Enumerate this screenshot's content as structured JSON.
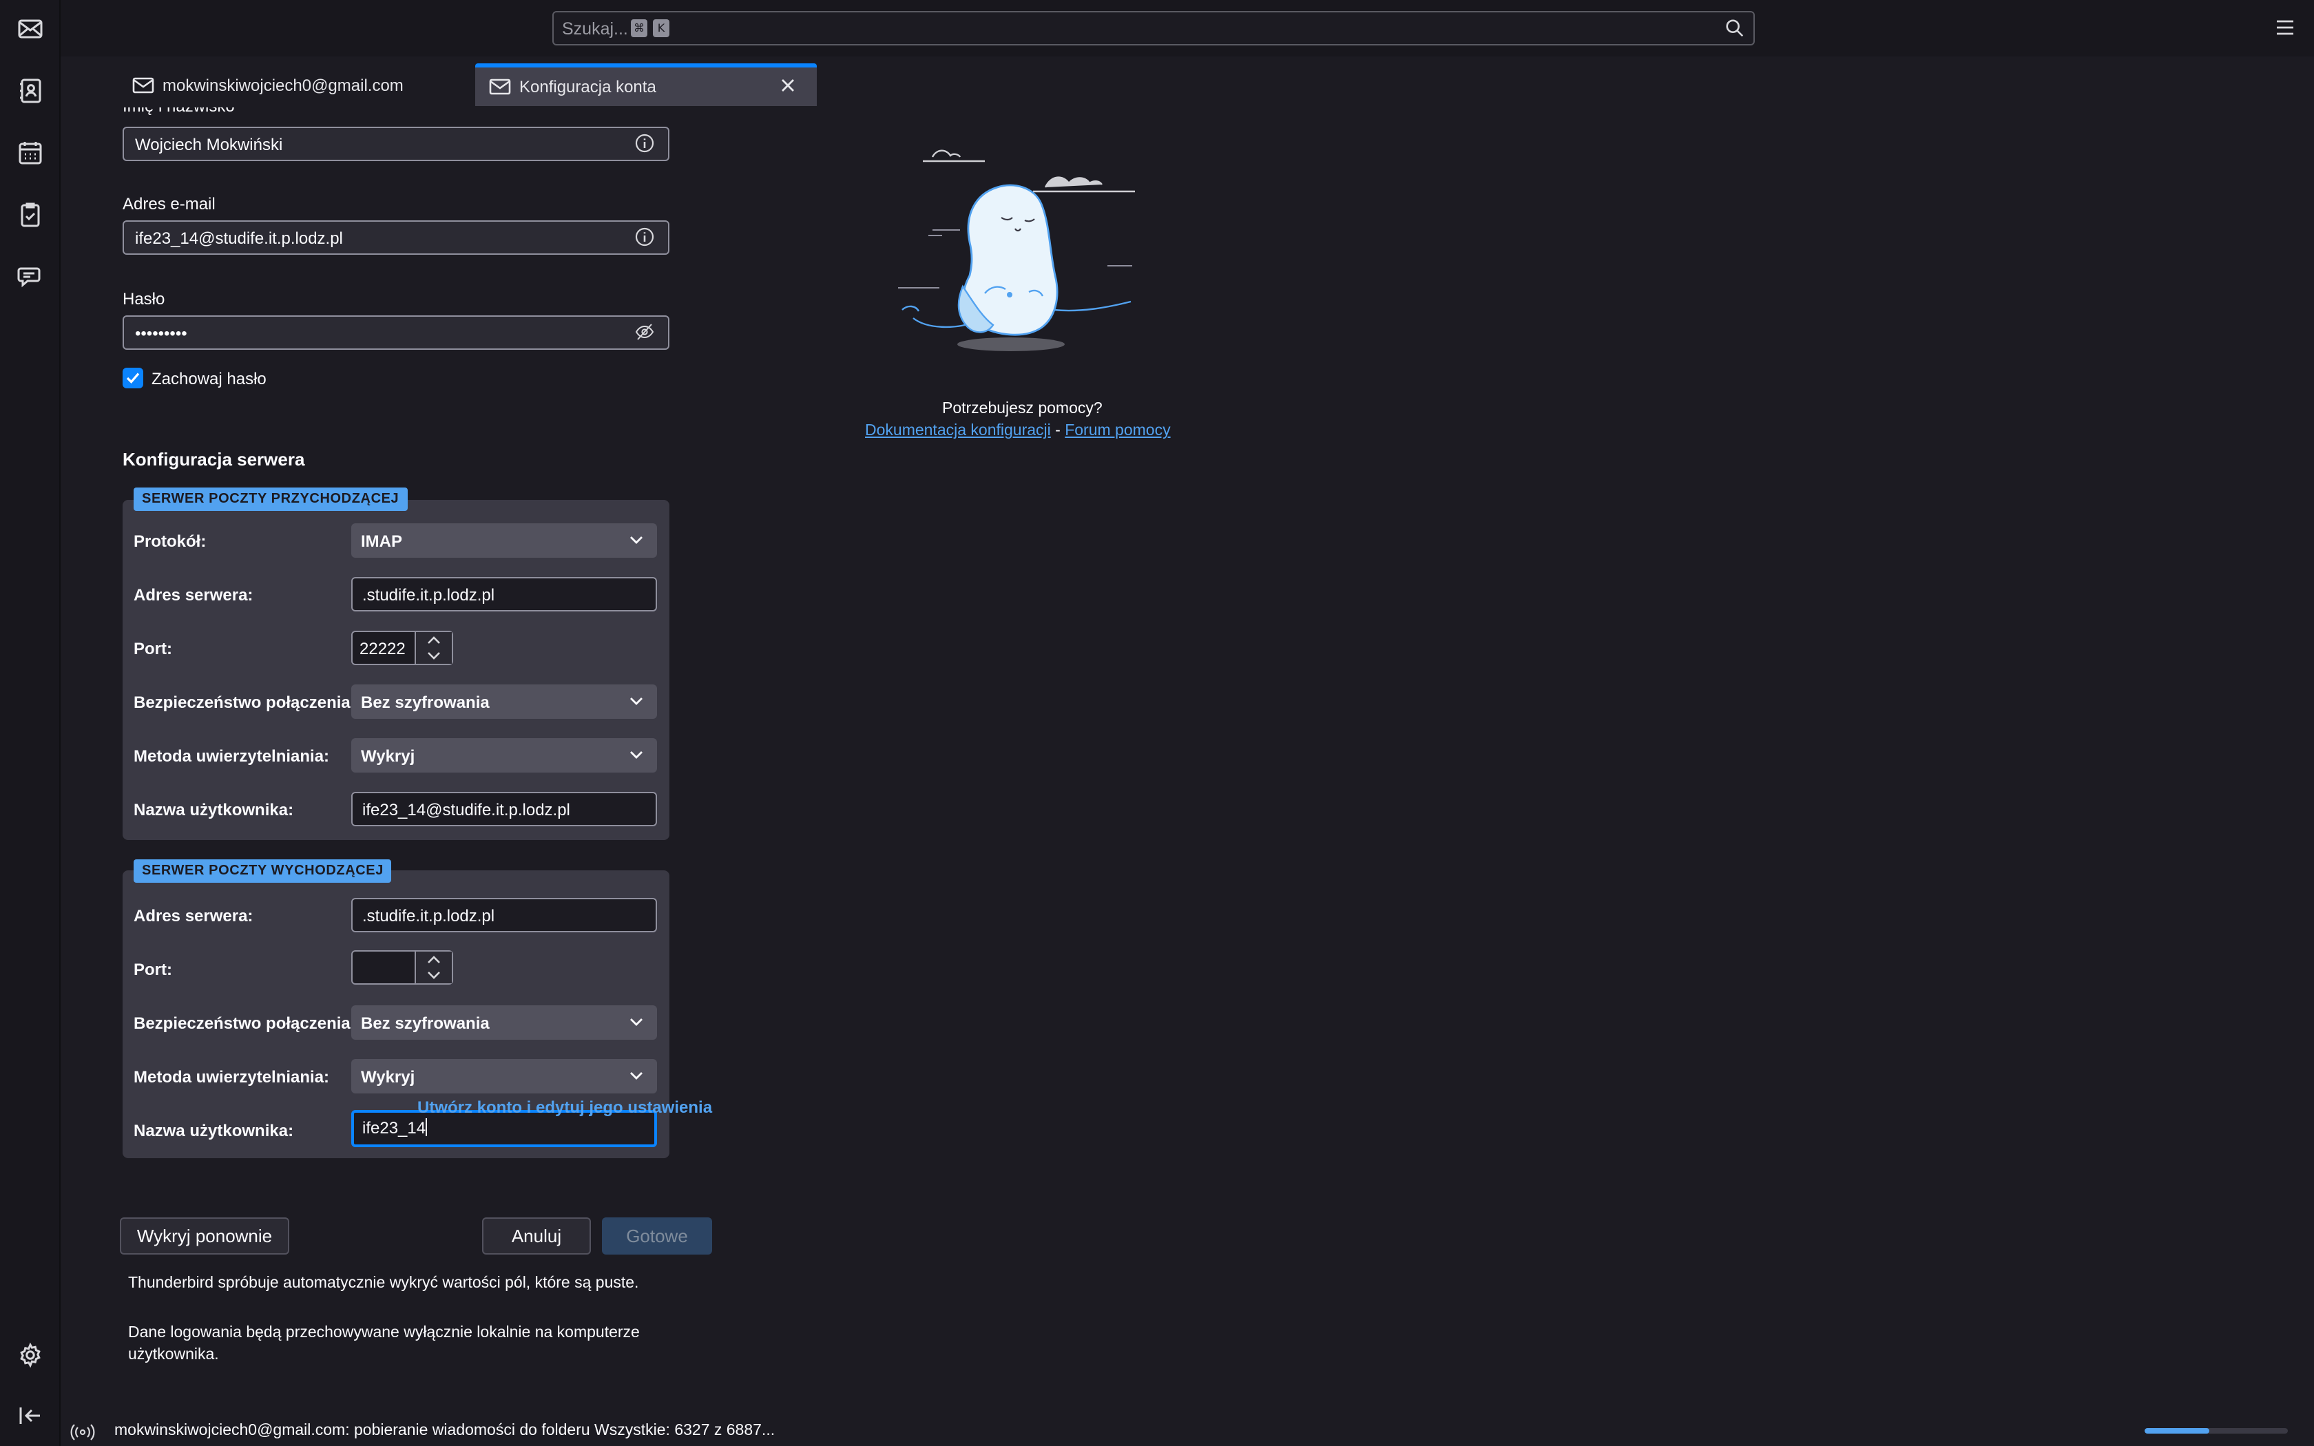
{
  "search": {
    "placeholder": "Szukaj...",
    "kbd1": "⌘",
    "kbd2": "K"
  },
  "tabs": [
    {
      "label": "mokwinskiwojciech0@gmail.com"
    },
    {
      "label": "Konfiguracja konta"
    }
  ],
  "form": {
    "name_label": "Imię i nazwisko",
    "name_value": "Wojciech Mokwiński",
    "email_label": "Adres e-mail",
    "email_value": "ife23_14@studife.it.p.lodz.pl",
    "password_label": "Hasło",
    "password_value": "•••••••••",
    "remember_label": "Zachowaj hasło",
    "remember_checked": true
  },
  "server_config": {
    "title": "Konfiguracja serwera",
    "incoming": {
      "badge": "SERWER POCZTY PRZYCHODZĄCEJ",
      "protocol_label": "Protokół:",
      "protocol_value": "IMAP",
      "address_label": "Adres serwera:",
      "address_value": ".studife.it.p.lodz.pl",
      "port_label": "Port:",
      "port_value": "22222",
      "security_label": "Bezpieczeństwo połączenia:",
      "security_value": "Bez szyfrowania",
      "auth_label": "Metoda uwierzytelniania:",
      "auth_value": "Wykryj",
      "username_label": "Nazwa użytkownika:",
      "username_value": "ife23_14@studife.it.p.lodz.pl"
    },
    "outgoing": {
      "badge": "SERWER POCZTY WYCHODZĄCEJ",
      "address_label": "Adres serwera:",
      "address_value": ".studife.it.p.lodz.pl",
      "port_label": "Port:",
      "port_value": "",
      "security_label": "Bezpieczeństwo połączenia:",
      "security_value": "Bez szyfrowania",
      "auth_label": "Metoda uwierzytelniania:",
      "auth_value": "Wykryj",
      "username_label": "Nazwa użytkownika:",
      "username_value": "ife23_14"
    }
  },
  "actions": {
    "create_link": "Utwórz konto i edytuj jego ustawienia",
    "redetect": "Wykryj ponownie",
    "cancel": "Anuluj",
    "done": "Gotowe"
  },
  "notes": {
    "auto_detect": "Thunderbird spróbuje automatycznie wykryć wartości pól, które są puste.",
    "local_storage": "Dane logowania będą przechowywane wyłącznie lokalnie na komputerze użytkownika."
  },
  "help": {
    "title": "Potrzebujesz pomocy?",
    "doc_link": "Dokumentacja konfiguracji",
    "separator": " - ",
    "forum_link": "Forum pomocy"
  },
  "status": {
    "text": "mokwinskiwojciech0@gmail.com: pobieranie wiadomości do folderu Wszystkie: 6327 z 6887...",
    "progress_fraction": 0.45
  },
  "colors": {
    "accent": "#0a84ff",
    "link": "#52a2f0",
    "background": "#1c1b22"
  },
  "icons": [
    "mail-icon",
    "address-book-icon",
    "calendar-icon",
    "tasks-icon",
    "chat-icon",
    "settings-icon",
    "collapse-sidebar-icon",
    "search-icon",
    "menu-icon",
    "info-icon",
    "hide-password-icon",
    "chevron-down-icon",
    "activity-icon"
  ]
}
